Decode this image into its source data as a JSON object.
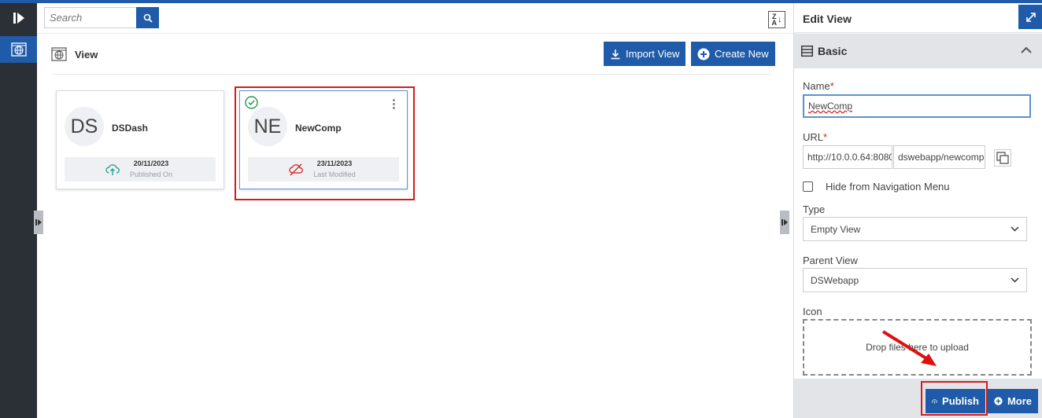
{
  "search": {
    "placeholder": "Search"
  },
  "main": {
    "title": "View",
    "import_label": "Import View",
    "create_label": "Create New",
    "sort_glyph_top": "Z",
    "sort_glyph_bottom": "A"
  },
  "cards": [
    {
      "initials": "DS",
      "name": "DSDash",
      "date": "20/11/2023",
      "sub": "Published On",
      "status": "published"
    },
    {
      "initials": "NE",
      "name": "NewComp",
      "date": "23/11/2023",
      "sub": "Last Modified",
      "status": "unpublished",
      "selected": true
    }
  ],
  "panel": {
    "title": "Edit View",
    "section": "Basic",
    "name_label": "Name",
    "name_value": "NewComp",
    "url_label": "URL",
    "url_base": "http://10.0.0.64:8080",
    "url_path": "dswebapp/newcomp",
    "hide_label": "Hide from Navigation Menu",
    "type_label": "Type",
    "type_value": "Empty View",
    "parent_label": "Parent View",
    "parent_value": "DSWebapp",
    "icon_label": "Icon",
    "drop_text": "Drop files here to upload",
    "publish_label": "Publish",
    "more_label": "More",
    "required_mark": "*"
  },
  "colors": {
    "accent": "#1f5ba8",
    "highlight": "#d41b1b",
    "published": "#1a9c8c",
    "unpublished": "#d41b1b"
  }
}
